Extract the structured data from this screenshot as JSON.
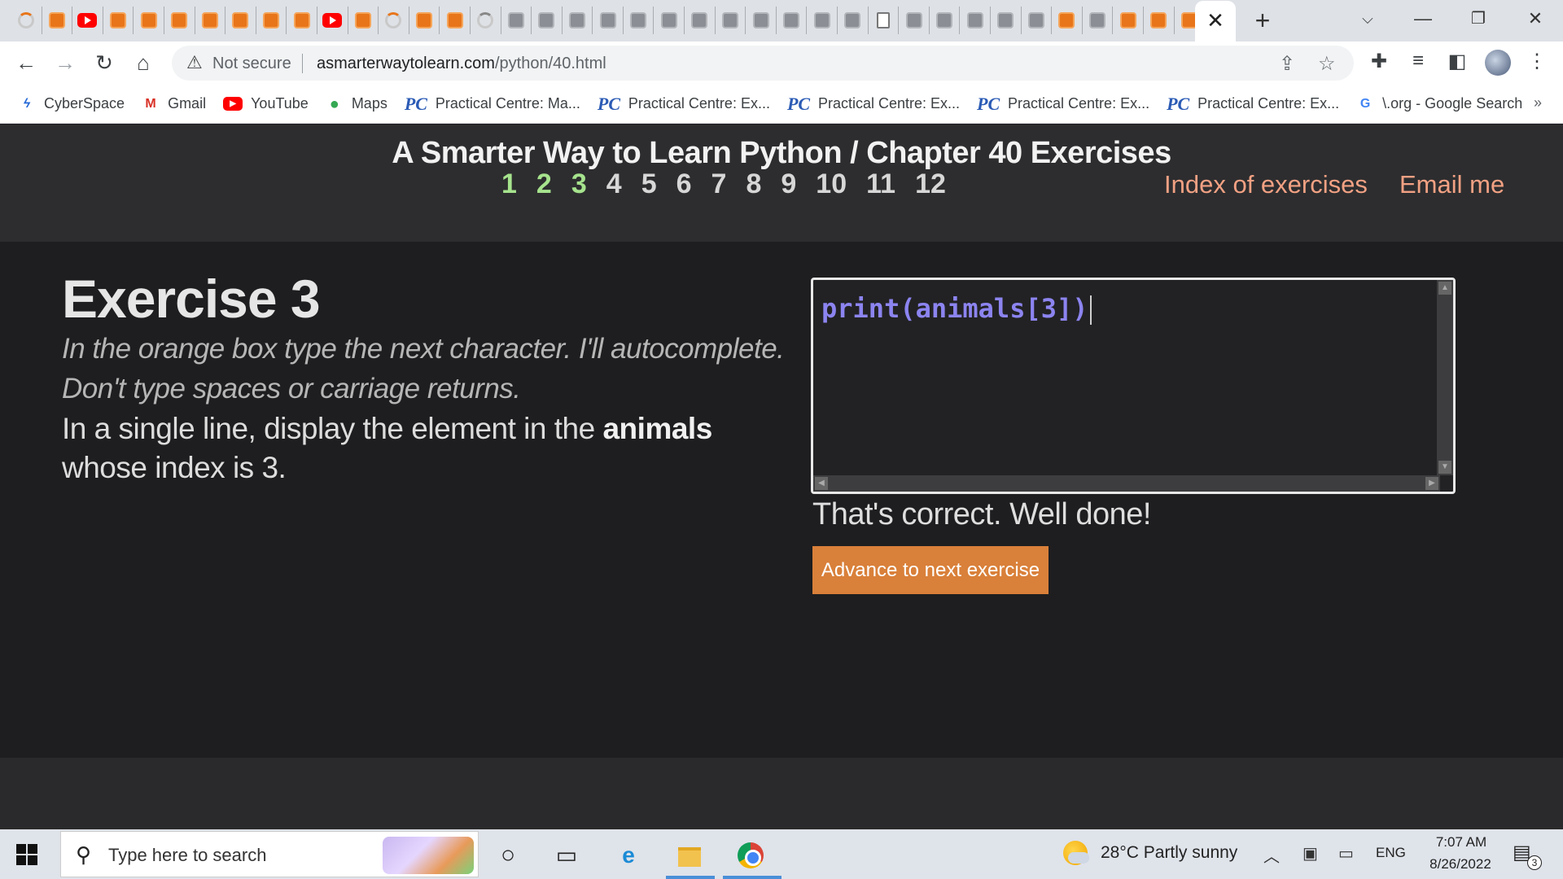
{
  "browser": {
    "tab_favicons": [
      "spinner-orange",
      "book",
      "youtube",
      "book",
      "book",
      "book",
      "book",
      "book",
      "book",
      "book",
      "youtube",
      "book",
      "spinner-orange",
      "book",
      "book",
      "spinner-grey",
      "book-grey",
      "book-grey",
      "book-grey",
      "book-grey",
      "book-grey",
      "book-grey",
      "book-grey",
      "book-grey",
      "book-grey",
      "book-grey",
      "book-grey",
      "book-grey",
      "blank-doc",
      "book-grey",
      "book-grey",
      "book-grey",
      "book-grey",
      "book-grey",
      "book",
      "book-grey",
      "book",
      "book",
      "book"
    ],
    "close_tab_symbol": "✕",
    "new_tab_symbol": "+",
    "address": {
      "security_label": "Not secure",
      "url_host": "asmarterwaytolearn.com",
      "url_path": "/python/40.html"
    },
    "bookmarks": [
      {
        "label": "CyberSpace",
        "icon": "cyberspace-icon"
      },
      {
        "label": "Gmail",
        "icon": "gmail-icon"
      },
      {
        "label": "YouTube",
        "icon": "youtube-icon"
      },
      {
        "label": "Maps",
        "icon": "maps-icon"
      },
      {
        "label": "Practical Centre: Ma...",
        "icon": "pc-icon"
      },
      {
        "label": "Practical Centre: Ex...",
        "icon": "pc-icon"
      },
      {
        "label": "Practical Centre: Ex...",
        "icon": "pc-icon"
      },
      {
        "label": "Practical Centre: Ex...",
        "icon": "pc-icon"
      },
      {
        "label": "Practical Centre: Ex...",
        "icon": "pc-icon"
      },
      {
        "label": "\\.org - Google Search",
        "icon": "google-icon"
      }
    ],
    "bookmarks_overflow": "»"
  },
  "site": {
    "title": "A Smarter Way to Learn Python / Chapter 40 Exercises",
    "exercise_numbers": [
      {
        "n": "1",
        "done": true
      },
      {
        "n": "2",
        "done": true
      },
      {
        "n": "3",
        "done": true
      },
      {
        "n": "4",
        "done": false
      },
      {
        "n": "5",
        "done": false
      },
      {
        "n": "6",
        "done": false
      },
      {
        "n": "7",
        "done": false
      },
      {
        "n": "8",
        "done": false
      },
      {
        "n": "9",
        "done": false
      },
      {
        "n": "10",
        "done": false
      },
      {
        "n": "11",
        "done": false
      },
      {
        "n": "12",
        "done": false
      }
    ],
    "index_link": "Index of exercises",
    "email_link": "Email me",
    "colors": {
      "done_number": "#a6e38d",
      "link": "#f2a183",
      "button": "#d9803a",
      "code": "#8c84f0"
    }
  },
  "exercise": {
    "title": "Exercise 3",
    "instruction_line1": "In the orange box type the next character. I'll autocomplete.",
    "instruction_line2": "Don't type spaces or carriage returns.",
    "task_line1_pre": "In a single line, display the element in the ",
    "task_line1_bold": "animals",
    "task_line2": "whose index is 3.",
    "code": "print(animals[3])",
    "feedback": "That's correct. Well done!",
    "advance_button": "Advance to next exercise"
  },
  "taskbar": {
    "search_placeholder": "Type here to search",
    "weather": "28°C  Partly sunny",
    "language": "ENG",
    "time": "7:07 AM",
    "date": "8/26/2022",
    "notification_count": "3"
  }
}
